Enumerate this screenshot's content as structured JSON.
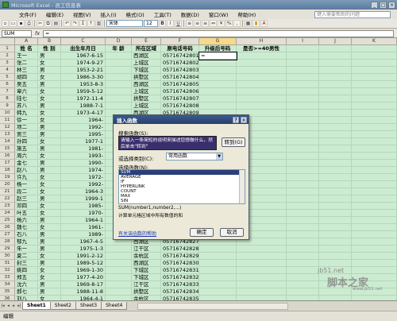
{
  "window": {
    "title": "Microsoft Excel - 员工信息表"
  },
  "menu": {
    "items": [
      "文件(F)",
      "编辑(E)",
      "视图(V)",
      "插入(I)",
      "格式(O)",
      "工具(T)",
      "数据(D)",
      "窗口(W)",
      "帮助(H)"
    ],
    "help_placeholder": "键入需要帮助的问题"
  },
  "toolbar": {
    "font_name": "宋体",
    "font_size": "12"
  },
  "formula_bar": {
    "name_box": "SUM",
    "fx": "fx",
    "value": "="
  },
  "columns": [
    "A",
    "B",
    "C",
    "D",
    "E",
    "F",
    "G",
    "H",
    "I",
    "J",
    "K"
  ],
  "headers": [
    "姓 名",
    "性 别",
    "出生年月日",
    "年 龄",
    "所在区域",
    "原电话号码",
    "升级后号码",
    "是否>=40男性"
  ],
  "rows": [
    [
      "王一",
      "男",
      "1967-6-15",
      "",
      "西湖区",
      "05716742801",
      "="
    ],
    [
      "张二",
      "女",
      "1974-9-27",
      "",
      "上城区",
      "05716742802",
      ""
    ],
    [
      "林三",
      "男",
      "1953-2-21",
      "",
      "下城区",
      "05716742803",
      ""
    ],
    [
      "胡四",
      "女",
      "1986-3-30",
      "",
      "拱墅区",
      "05716742804",
      ""
    ],
    [
      "吴五",
      "男",
      "1953-8-3",
      "",
      "西湖区",
      "05716742805",
      ""
    ],
    [
      "章六",
      "女",
      "1959-5-12",
      "",
      "上城区",
      "05716742806",
      ""
    ],
    [
      "陆七",
      "女",
      "1972-11-4",
      "",
      "拱墅区",
      "05716742807",
      ""
    ],
    [
      "苏八",
      "男",
      "1988-7-1",
      "",
      "上城区",
      "05716742808",
      ""
    ],
    [
      "韩九",
      "女",
      "1973-4-17",
      "",
      "西湖区",
      "05716742809",
      ""
    ],
    [
      "徐一",
      "女",
      "1964-",
      "",
      "",
      "",
      ""
    ],
    [
      "项二",
      "男",
      "1992-",
      "",
      "",
      "",
      ""
    ],
    [
      "贾三",
      "男",
      "1995-",
      "",
      "",
      "",
      ""
    ],
    [
      "孙四",
      "女",
      "1977-1",
      "",
      "",
      "",
      ""
    ],
    [
      "施五",
      "男",
      "1981-",
      "",
      "",
      "",
      ""
    ],
    [
      "周六",
      "女",
      "1993-",
      "",
      "",
      "",
      ""
    ],
    [
      "金七",
      "男",
      "1990-",
      "",
      "",
      "",
      ""
    ],
    [
      "赵八",
      "男",
      "1974-",
      "",
      "",
      "",
      ""
    ],
    [
      "许九",
      "女",
      "1972-",
      "",
      "",
      "",
      ""
    ],
    [
      "杨一",
      "女",
      "1992-",
      "",
      "",
      "",
      ""
    ],
    [
      "段二",
      "女",
      "1964-3",
      "",
      "",
      "",
      ""
    ],
    [
      "赵三",
      "男",
      "1999-1",
      "",
      "",
      "",
      ""
    ],
    [
      "邓四",
      "女",
      "1985-",
      "",
      "",
      "",
      ""
    ],
    [
      "叶五",
      "女",
      "1970-",
      "",
      "",
      "",
      ""
    ],
    [
      "杨六",
      "男",
      "1964-1",
      "",
      "",
      "",
      ""
    ],
    [
      "魏七",
      "女",
      "1961-",
      "",
      "",
      "",
      ""
    ],
    [
      "石八",
      "男",
      "1989-",
      "",
      "",
      "",
      ""
    ],
    [
      "郁九",
      "男",
      "1967-4-5",
      "",
      "西湖区",
      "05716742827",
      ""
    ],
    [
      "朱一",
      "男",
      "1975-1-3",
      "",
      "江干区",
      "05716742828",
      ""
    ],
    [
      "夏二",
      "女",
      "1991-2-12",
      "",
      "余杭区",
      "05716742829",
      ""
    ],
    [
      "封三",
      "男",
      "1989-5-12",
      "",
      "西湖区",
      "05716742830",
      ""
    ],
    [
      "姚四",
      "女",
      "1969-1-30",
      "",
      "下城区",
      "05716742831",
      ""
    ],
    [
      "郑五",
      "女",
      "1977-4-20",
      "",
      "下城区",
      "05716742832",
      ""
    ],
    [
      "沈六",
      "男",
      "1969-8-17",
      "",
      "江干区",
      "05716742833",
      ""
    ],
    [
      "郝七",
      "男",
      "1988-11-8",
      "",
      "拱墅区",
      "05716742834",
      ""
    ],
    [
      "刘八",
      "女",
      "1964-4-1",
      "",
      "余杭区",
      "05716742835",
      ""
    ]
  ],
  "sheet_tabs": [
    "Sheet1",
    "Sheet2",
    "Sheet3",
    "Sheet4"
  ],
  "status": "编辑",
  "dialog": {
    "title": "插入函数",
    "search_label": "搜索函数(S):",
    "search_text": "请输入一条简短的说明来描述您想做什么，然后单击\"转到\"",
    "go_label": "转到(G)",
    "category_label": "或选择类别(C):",
    "category_value": "常用函数",
    "select_label": "选择函数(N):",
    "functions": [
      "SUM",
      "AVERAGE",
      "IF",
      "HYPERLINK",
      "COUNT",
      "MAX",
      "SIN"
    ],
    "signature": "SUM(number1,number2,...)",
    "description": "计算单元格区域中所有数值的和",
    "help_link": "有关该函数的帮助",
    "ok_label": "确定",
    "cancel_label": "取消"
  },
  "watermark": {
    "main": "脚本之家",
    "url": "jb51.net",
    "sub": "www.jb51.net"
  }
}
